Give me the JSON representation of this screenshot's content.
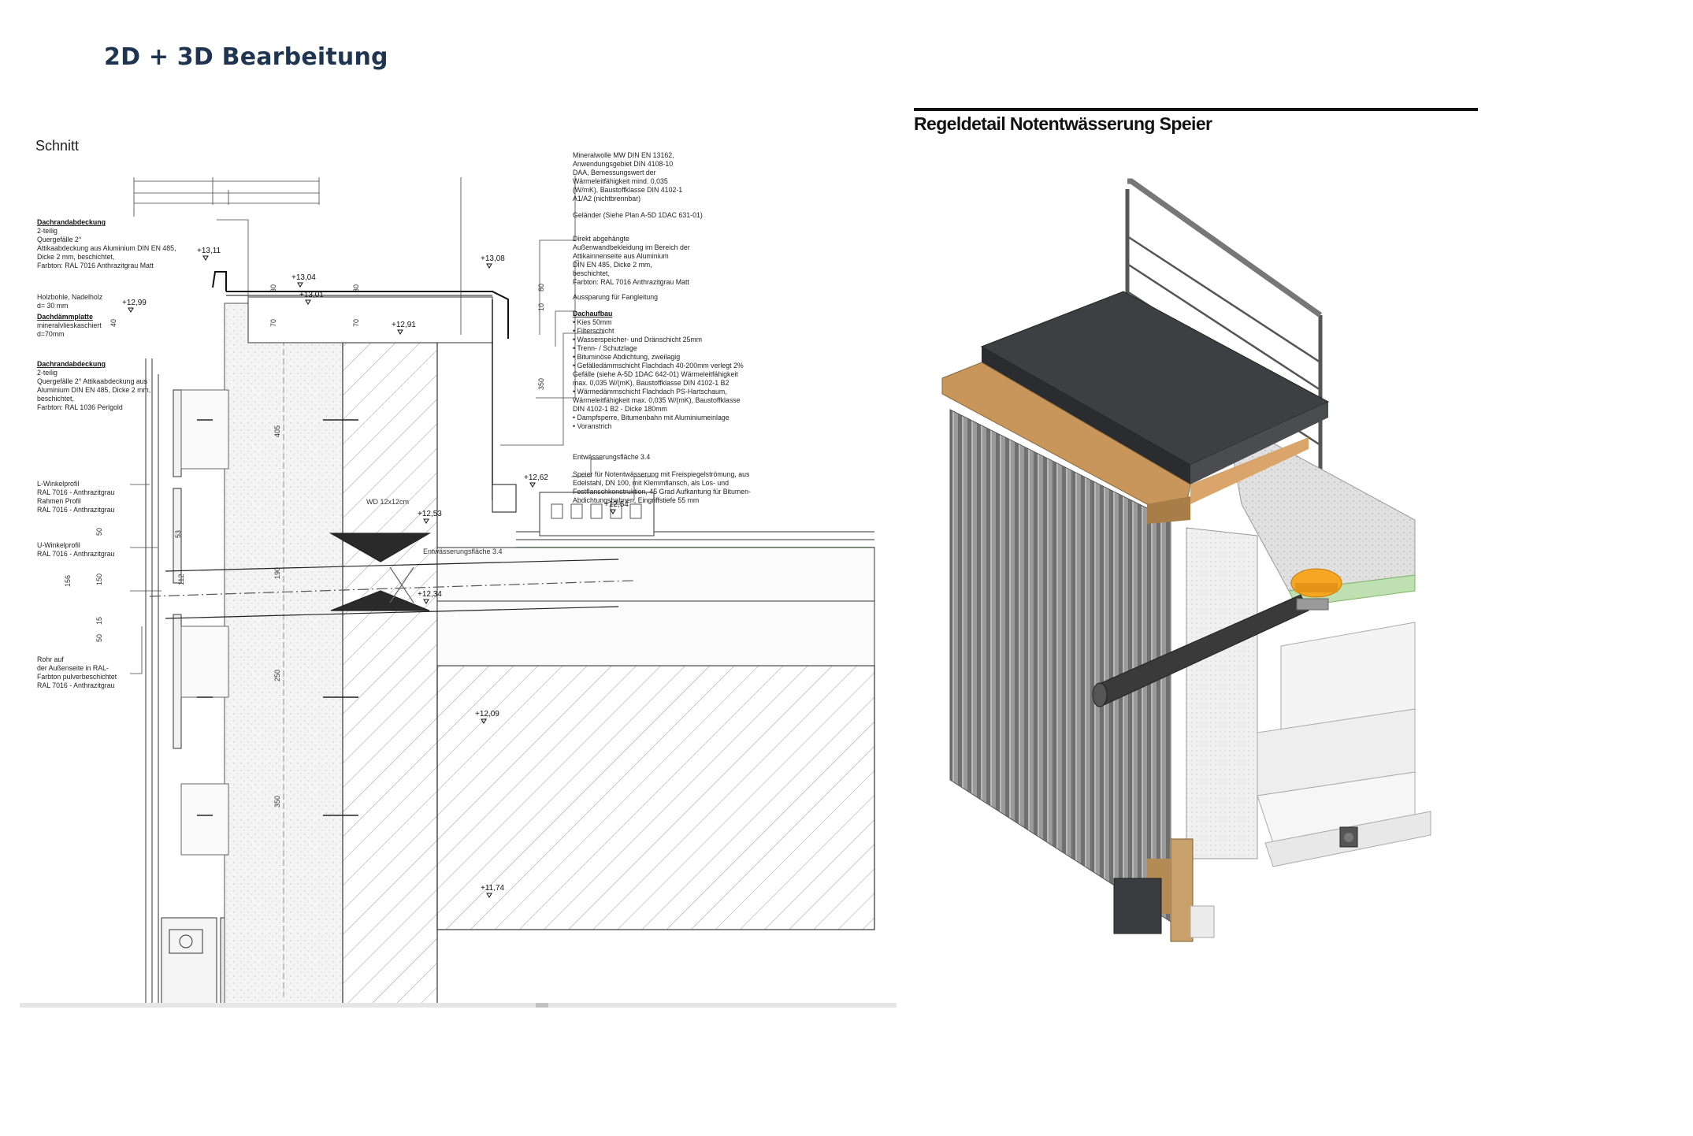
{
  "page": {
    "title": "2D + 3D Bearbeitung"
  },
  "section_drawing": {
    "label": "Schnitt",
    "notes_left": [
      {
        "head": "Dachrandabdeckung",
        "lines": [
          "2-teilig",
          "Quergefälle 2°",
          "Attikaabdeckung aus Aluminium DIN EN 485,",
          "Dicke 2 mm, beschichtet,",
          "Farbton: RAL 7016 Anthrazitgrau Matt"
        ]
      },
      {
        "head": "",
        "lines": [
          "Holzbohle, Nadelholz",
          "d= 30 mm"
        ]
      },
      {
        "head": "Dachdämmplatte",
        "lines": [
          "mineralvlieskaschiert",
          "d=70mm"
        ]
      },
      {
        "head": "Dachrandabdeckung",
        "lines": [
          "2-teilig",
          "Quergefälle 2° Attikaabdeckung aus",
          "Aluminium DIN EN 485, Dicke 2 mm,",
          "beschichtet,",
          "Farbton: RAL 1036 Perlgold"
        ]
      },
      {
        "head": "",
        "lines": [
          "L-Winkelprofil",
          "RAL 7016 - Anthrazitgrau",
          "Rahmen Profil",
          "RAL 7016 - Anthrazitgrau"
        ]
      },
      {
        "head": "",
        "lines": [
          "U-Winkelprofil",
          "RAL 7016 - Anthrazitgrau"
        ]
      },
      {
        "head": "",
        "lines": [
          "Rohr auf",
          "der Außenseite in RAL-",
          "Farbton pulverbeschichtet",
          "RAL 7016 - Anthrazitgrau"
        ]
      }
    ],
    "notes_right": [
      {
        "head": "",
        "lines": [
          "Mineralwolle MW DIN EN 13162,",
          "Anwendungsgebiet DIN 4108-10",
          "DAA, Bemessungswert der",
          "Wärmeleitfähigkeit mind. 0,035",
          "(W/mK), Baustoffklasse DIN 4102-1",
          "A1/A2 (nichtbrennbar)"
        ]
      },
      {
        "head": "",
        "lines": [
          "Geländer (Siehe Plan A-5D 1DAC 631-01)"
        ]
      },
      {
        "head": "",
        "lines": [
          "Direkt abgehängte",
          "Außenwandbekleidung im Bereich der",
          "Attikainnenseite aus Aluminium",
          "DIN EN 485, Dicke 2 mm,",
          "beschichtet,",
          "Farbton: RAL 7016 Anthrazitgrau Matt"
        ]
      },
      {
        "head": "",
        "lines": [
          "Aussparung für Fangleitung"
        ]
      },
      {
        "head": "Dachaufbau",
        "lines": [
          "• Kies 50mm",
          "• Filterschicht",
          "• Wasserspeicher- und Dränschicht 25mm",
          "• Trenn- / Schutzlage",
          "• Bituminöse Abdichtung, zweilagig",
          "• Gefälledämmschicht Flachdach 40-200mm verlegt 2%",
          "   Gefälle (siehe A-5D 1DAC 642-01) Wärmeleitfähigkeit",
          "   max. 0,035 W/(mK), Baustoffklasse DIN 4102-1 B2",
          "• Wärmedämmschicht Flachdach PS-Hartschaum,",
          "   Wärmeleitfähigkeit max. 0,035 W/(mK), Baustoffklasse",
          "   DIN 4102-1 B2 - Dicke 180mm",
          "• Dampfsperre, Bitumenbahn mit Aluminiumeinlage",
          "• Voranstrich"
        ]
      },
      {
        "head": "",
        "lines": [
          "Entwässerungsfläche 3.4"
        ]
      },
      {
        "head": "",
        "lines": [
          "Speier für Notentwässerung mit Freispiegelströmung, aus",
          "Edelstahl, DN 100, mit Klemmflansch, als Los- und",
          "Festflanschkonstruktion, 45 Grad Aufkantung für Bitumen-",
          "Abdichtungsbahnen, Eingriffstiefe 55 mm"
        ]
      }
    ],
    "levels": [
      "+13,11",
      "+13,08",
      "+13,04",
      "+13,01",
      "+12,99",
      "+12,91",
      "+12,62",
      "+12,54",
      "+12,53",
      "+12,34",
      "+12,09",
      "+11,74"
    ],
    "dimensions": [
      "30",
      "70",
      "30",
      "70",
      "80",
      "10",
      "40",
      "405",
      "350",
      "53",
      "50",
      "190",
      "156",
      "150",
      "112",
      "15",
      "50",
      "250",
      "350"
    ],
    "inline_labels": {
      "wd": "WD 12x12cm",
      "drain": "Entwässerungsfläche 3.4"
    }
  },
  "detail_3d": {
    "title": "Regeldetail Notentwässerung Speier",
    "colors": {
      "cladding": "#8c8c8c",
      "coping_dark": "#3d3f42",
      "coping_gold": "#c8955a",
      "spout": "#f5a623",
      "timber": "#c9a16b",
      "insulation": "#ededed",
      "gravel": "#dcdcdc",
      "green_layer": "#bfe0b0"
    }
  }
}
